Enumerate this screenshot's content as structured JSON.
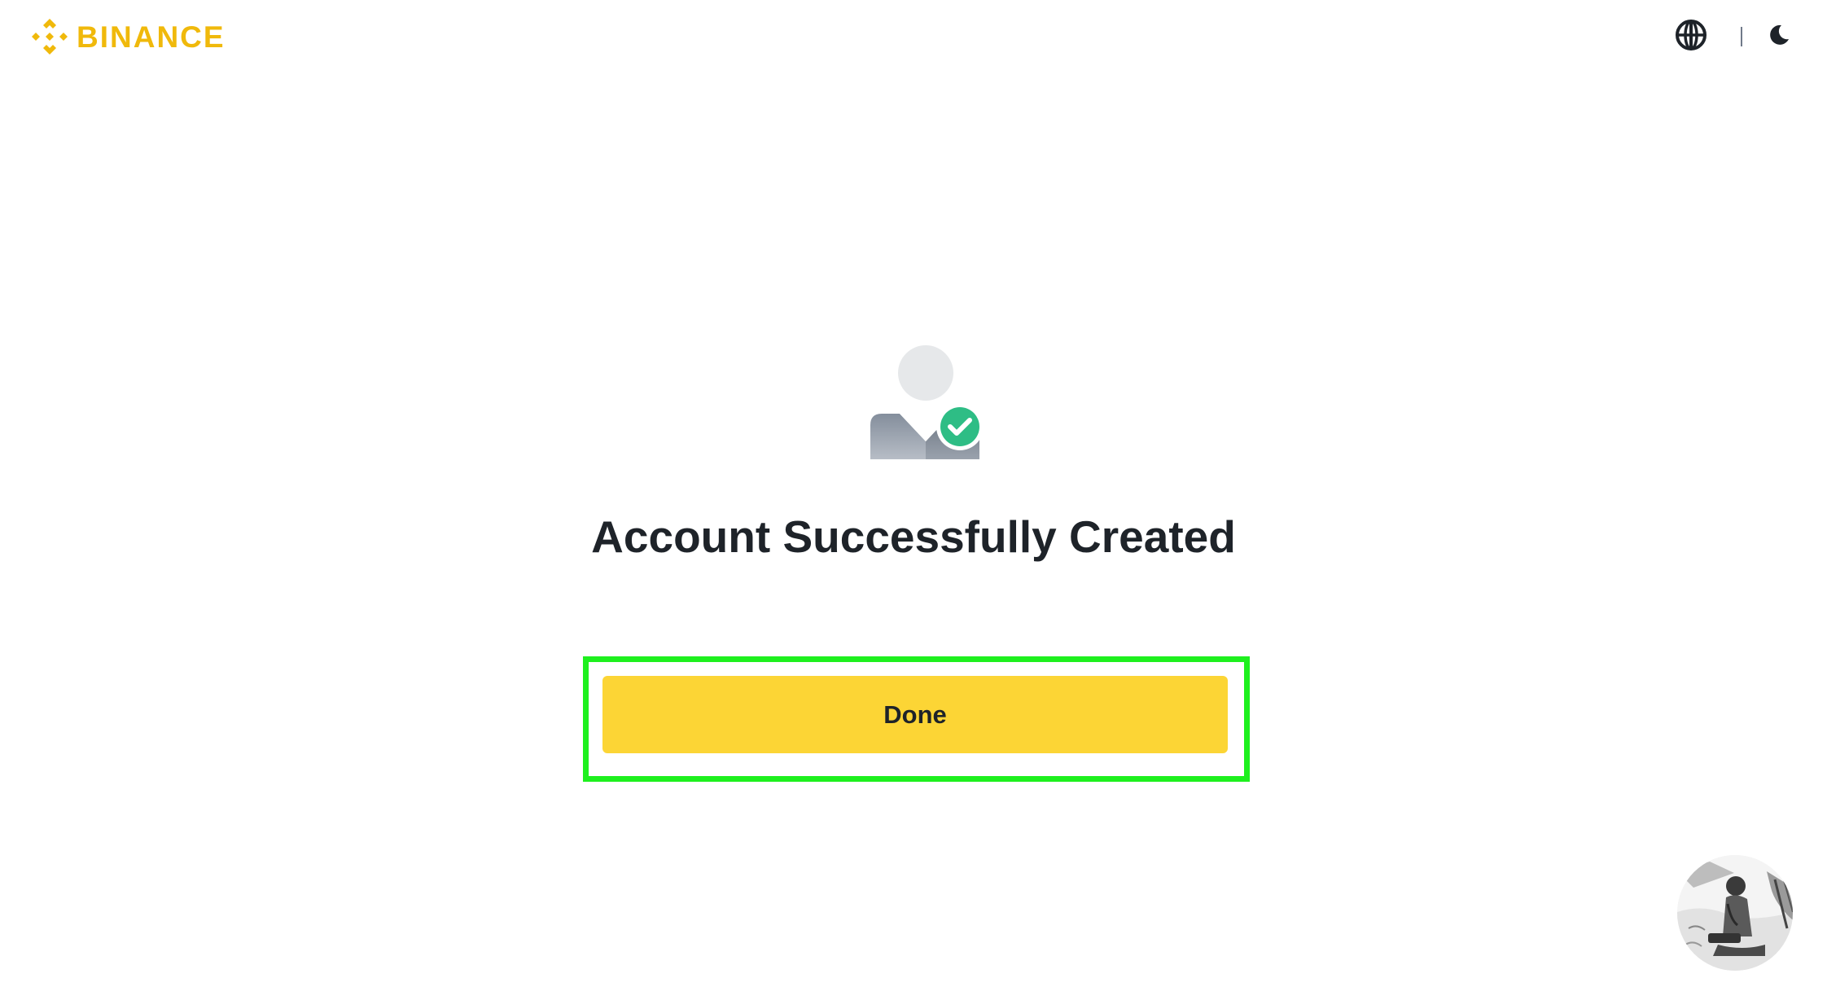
{
  "header": {
    "brand_name": "BINANCE",
    "brand_color": "#F0B90B",
    "logo_icon": "binance-diamond-icon",
    "language_icon": "globe-icon",
    "theme_icon": "moon-icon"
  },
  "main": {
    "illustration_icon": "user-check-icon",
    "title": "Account Successfully Created",
    "done_button_label": "Done",
    "button_color": "#FCD535",
    "highlight_color": "#1EF01E",
    "success_color": "#2EBD85"
  },
  "floating": {
    "avatar_icon": "support-avatar-image"
  }
}
